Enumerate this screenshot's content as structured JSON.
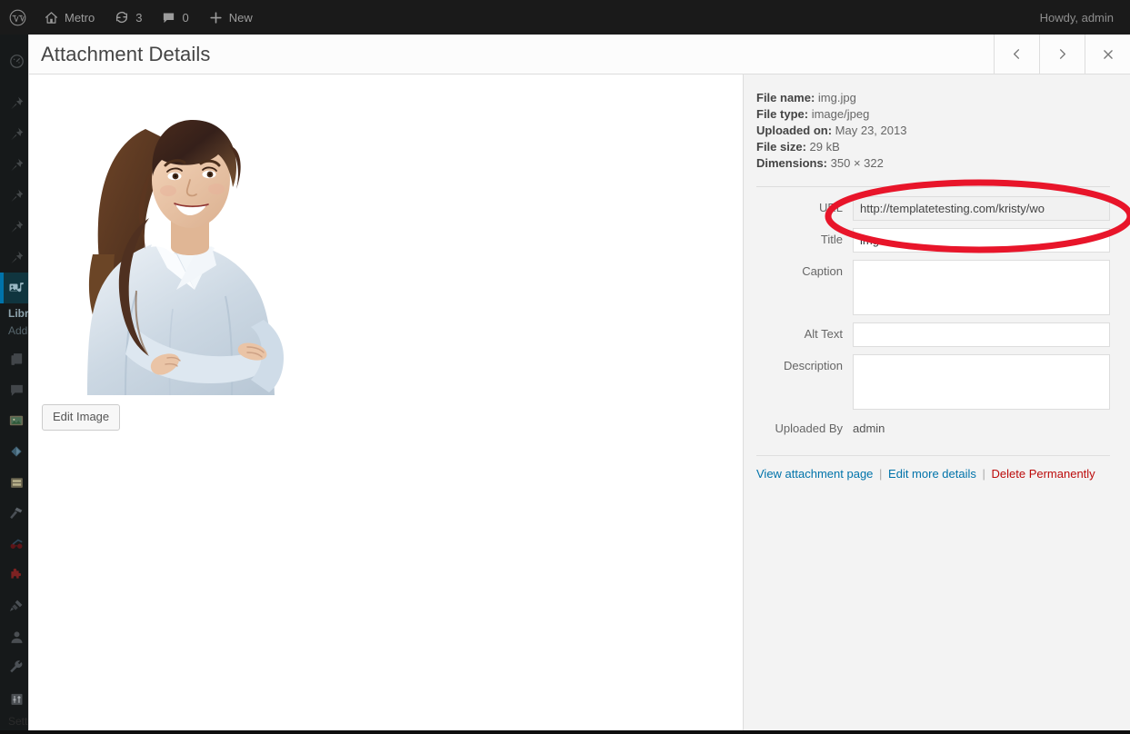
{
  "adminbar": {
    "logo_icon": "wordpress-logo-icon",
    "items": [
      {
        "icon": "home-icon",
        "label": "Metro"
      },
      {
        "icon": "updates-icon",
        "label": "3"
      },
      {
        "icon": "comment-icon",
        "label": "0"
      },
      {
        "icon": "plus-icon",
        "label": "New"
      }
    ],
    "account": "Howdy, admin"
  },
  "adminmenu": {
    "items": [
      {
        "icon": "dashboard-icon",
        "name": "dashboard"
      },
      {
        "icon": "pin-icon",
        "name": "posts"
      },
      {
        "icon": "pin-icon",
        "name": "pin-2"
      },
      {
        "icon": "pin-icon",
        "name": "pin-3"
      },
      {
        "icon": "pin-icon",
        "name": "pin-4"
      },
      {
        "icon": "pin-icon",
        "name": "pin-5"
      },
      {
        "icon": "pin-icon",
        "name": "pin-6"
      },
      {
        "icon": "media-icon",
        "name": "media",
        "current": true
      },
      {
        "icon": "pages-icon",
        "name": "pages"
      },
      {
        "icon": "comments-icon",
        "name": "comments"
      },
      {
        "icon": "gallery-icon",
        "name": "gallery"
      },
      {
        "icon": "appearance-icon",
        "name": "appearance"
      },
      {
        "icon": "list-icon",
        "name": "list"
      },
      {
        "icon": "hammer-icon",
        "name": "hammer"
      },
      {
        "icon": "glasses-icon",
        "name": "glasses"
      },
      {
        "icon": "puzzle-icon",
        "name": "plugins"
      },
      {
        "icon": "plug-icon",
        "name": "plug"
      },
      {
        "icon": "user-icon",
        "name": "users"
      },
      {
        "icon": "wrench-icon",
        "name": "tools"
      },
      {
        "icon": "settings-icon",
        "name": "settings"
      }
    ],
    "media_submenu": [
      {
        "label": "Library",
        "current": true
      },
      {
        "label": "Add New",
        "current": false
      }
    ],
    "settings_label": "Settings"
  },
  "modal": {
    "title": "Attachment Details",
    "prev_icon": "chevron-left-icon",
    "next_icon": "chevron-right-icon",
    "close_icon": "close-icon",
    "edit_image_label": "Edit Image",
    "image_alt": "Smiling woman with dark wavy hair wearing a light blue blouse, arms crossed, on a white background"
  },
  "details": {
    "meta": [
      {
        "label": "File name:",
        "value": "img.jpg"
      },
      {
        "label": "File type:",
        "value": "image/jpeg"
      },
      {
        "label": "Uploaded on:",
        "value": "May 23, 2013"
      },
      {
        "label": "File size:",
        "value": "29 kB"
      },
      {
        "label": "Dimensions:",
        "value": "350 × 322"
      }
    ],
    "fields": {
      "url_label": "URL",
      "url_value": "http://templatetesting.com/kristy/wo",
      "title_label": "Title",
      "title_value": "img",
      "caption_label": "Caption",
      "caption_value": "",
      "alt_label": "Alt Text",
      "alt_value": "",
      "description_label": "Description",
      "description_value": "",
      "uploaded_by_label": "Uploaded By",
      "uploaded_by_value": "admin"
    },
    "links": {
      "view": "View attachment page",
      "edit": "Edit more details",
      "delete": "Delete Permanently",
      "separator": "|"
    }
  },
  "annotation": {
    "shape": "ellipse",
    "color": "#e8152a",
    "target": "url-field"
  }
}
